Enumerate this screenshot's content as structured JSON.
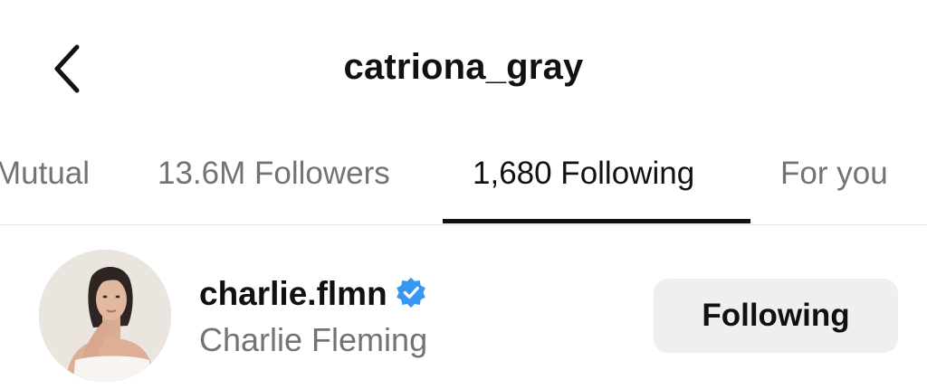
{
  "header": {
    "title": "catriona_gray",
    "back_icon": "chevron-left-icon"
  },
  "tabs": [
    {
      "label": "Mutual",
      "active": false
    },
    {
      "label": "13.6M Followers",
      "active": false
    },
    {
      "label": "1,680 Following",
      "active": true
    },
    {
      "label": "For you",
      "active": false
    }
  ],
  "list": {
    "items": [
      {
        "username": "charlie.flmn",
        "full_name": "Charlie Fleming",
        "verified": true,
        "verified_icon": "verified-badge-icon",
        "action_label": "Following"
      }
    ]
  },
  "colors": {
    "verified": "#3897f0",
    "secondary_text": "#737373",
    "button_bg": "#efeff1"
  }
}
